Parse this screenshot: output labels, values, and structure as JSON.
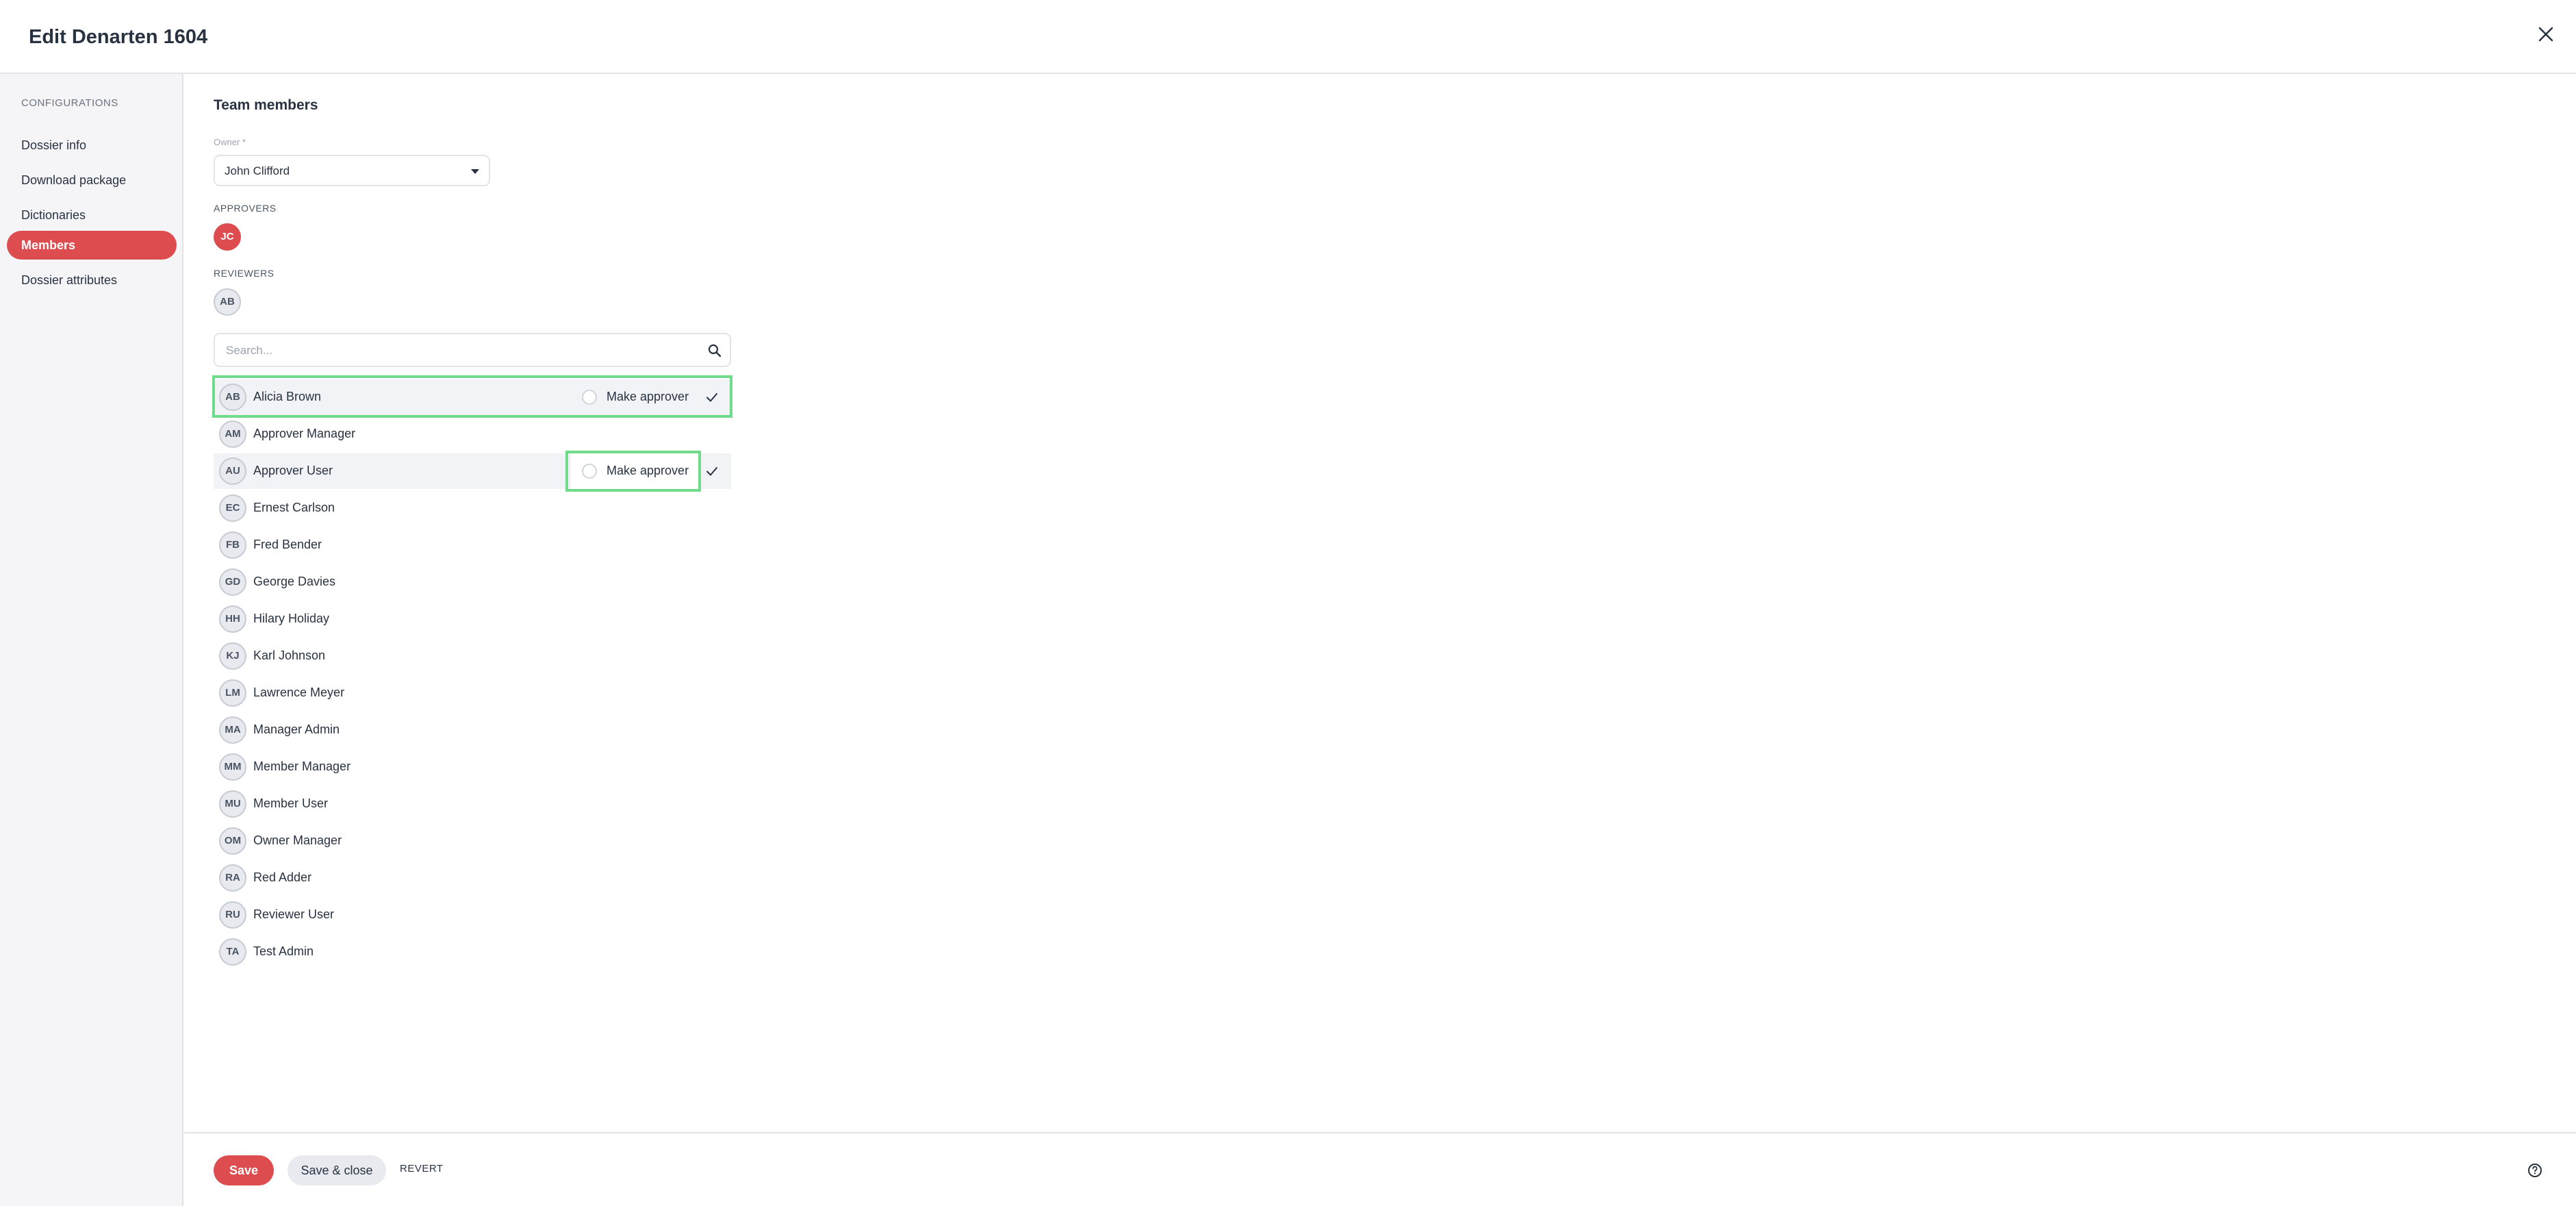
{
  "header": {
    "title": "Edit Denarten 1604",
    "close_icon": "close-icon"
  },
  "sidebar": {
    "heading": "CONFIGURATIONS",
    "items": [
      {
        "label": "Dossier info",
        "active": false
      },
      {
        "label": "Download package",
        "active": false
      },
      {
        "label": "Dictionaries",
        "active": false
      },
      {
        "label": "Members",
        "active": true
      },
      {
        "label": "Dossier attributes",
        "active": false
      }
    ]
  },
  "main": {
    "section_title": "Team members",
    "owner": {
      "label": "Owner *",
      "value": "John Clifford"
    },
    "approvers": {
      "label": "APPROVERS",
      "avatars": [
        "JC"
      ]
    },
    "reviewers": {
      "label": "REVIEWERS",
      "avatars": [
        "AB"
      ]
    },
    "search": {
      "placeholder": "Search..."
    },
    "make_approver_label": "Make approver",
    "members": [
      {
        "initials": "AB",
        "name": "Alicia Brown"
      },
      {
        "initials": "AM",
        "name": "Approver Manager"
      },
      {
        "initials": "AU",
        "name": "Approver User"
      },
      {
        "initials": "EC",
        "name": "Ernest Carlson"
      },
      {
        "initials": "FB",
        "name": "Fred Bender"
      },
      {
        "initials": "GD",
        "name": "George Davies"
      },
      {
        "initials": "HH",
        "name": "Hilary Holiday"
      },
      {
        "initials": "KJ",
        "name": "Karl Johnson"
      },
      {
        "initials": "LM",
        "name": "Lawrence Meyer"
      },
      {
        "initials": "MA",
        "name": "Manager Admin"
      },
      {
        "initials": "MM",
        "name": "Member Manager"
      },
      {
        "initials": "MU",
        "name": "Member User"
      },
      {
        "initials": "OM",
        "name": "Owner Manager"
      },
      {
        "initials": "RA",
        "name": "Red Adder"
      },
      {
        "initials": "RU",
        "name": "Reviewer User"
      },
      {
        "initials": "TA",
        "name": "Test Admin"
      }
    ]
  },
  "footer": {
    "save_label": "Save",
    "save_close_label": "Save & close",
    "revert_label": "REVERT",
    "help_icon": "help-circle-icon"
  },
  "colors": {
    "accent": "#dd4d50",
    "highlight": "#6fdc8c"
  }
}
